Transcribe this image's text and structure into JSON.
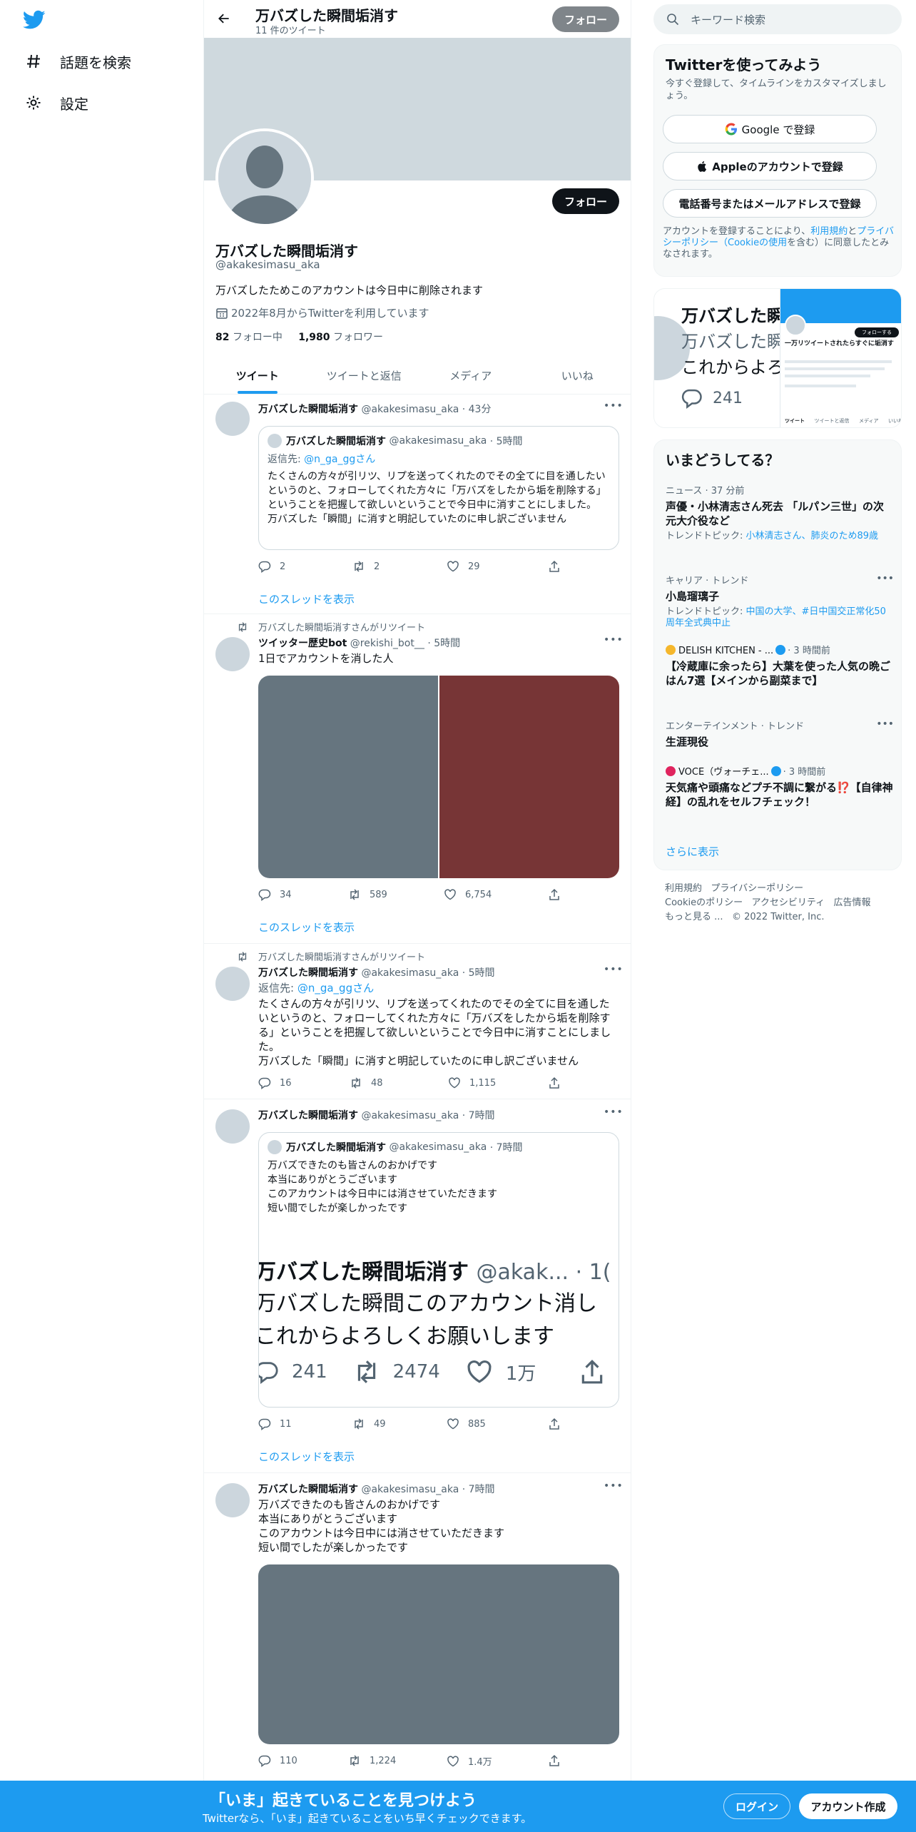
{
  "nav": {
    "items": [
      {
        "label": "話題を検索",
        "icon": "hashtag-icon"
      },
      {
        "label": "設定",
        "icon": "gear-icon"
      }
    ]
  },
  "header": {
    "name": "万バズした瞬間垢消す",
    "count": "11 件のツイート",
    "follow": "フォロー"
  },
  "profile": {
    "follow": "フォロー",
    "name": "万バズした瞬間垢消す",
    "handle": "@akakesimasu_aka",
    "bio": "万バズしたためこのアカウントは今日中に削除されます",
    "joined": "2022年8月からTwitterを利用しています",
    "following_count": "82",
    "following_label": "フォロー中",
    "followers_count": "1,980",
    "followers_label": "フォロワー"
  },
  "tabs": [
    "ツイート",
    "ツイートと返信",
    "メディア",
    "いいね"
  ],
  "tweets": [
    {
      "name": "万バズした瞬間垢消す",
      "handle": "@akakesimasu_aka",
      "time": "· 43分",
      "quote": {
        "name": "万バズした瞬間垢消す",
        "handle": "@akakesimasu_aka",
        "time": "· 5時間",
        "reply_prefix": "返信先: ",
        "reply_to": "@n_ga_ggさん",
        "text1": "たくさんの方々が引リツ、リプを送ってくれたのでその全てに目を通したいというのと、フォローしてくれた方々に「万バズをしたから垢を削除する」ということを把握して欲しいということで今日中に消すことにしました。",
        "text2": "万バズした「瞬間」に消すと明記していたのに申し訳ございません"
      },
      "replies": "2",
      "retweets": "2",
      "likes": "29",
      "show_thread": "このスレッドを表示"
    },
    {
      "rt_label": "万バズした瞬間垢消すさんがリツイート",
      "name": "ツイッター歴史bot",
      "handle": "@rekishi_bot__",
      "time": "· 5時間",
      "text": "1日でアカウントを消した人",
      "replies": "34",
      "retweets": "589",
      "likes": "6,754",
      "show_thread": "このスレッドを表示"
    },
    {
      "rt_label": "万バズした瞬間垢消すさんがリツイート",
      "name": "万バズした瞬間垢消す",
      "handle": "@akakesimasu_aka",
      "time": "· 5時間",
      "reply_prefix": "返信先: ",
      "reply_to": "@n_ga_ggさん",
      "text1": "たくさんの方々が引リツ、リプを送ってくれたのでその全てに目を通したいというのと、フォローしてくれた方々に「万バズをしたから垢を削除する」ということを把握して欲しいということで今日中に消すことにしました。",
      "text2": "万バズした「瞬間」に消すと明記していたのに申し訳ございません",
      "replies": "16",
      "retweets": "48",
      "likes": "1,115"
    },
    {
      "name": "万バズした瞬間垢消す",
      "handle": "@akakesimasu_aka",
      "time": "· 7時間",
      "quote": {
        "name": "万バズした瞬間垢消す",
        "handle": "@akakesimasu_aka",
        "time": "· 7時間",
        "lines": [
          "万バズできたのも皆さんのおかげです",
          "本当にありがとうございます",
          "このアカウントは今日中には消させていただきます",
          "短い間でしたが楽しかったです"
        ],
        "image_head": "万バズした瞬間垢消す",
        "image_handle": "@akak... · 1(",
        "image_line1": "万バズした瞬間このアカウント消し",
        "image_line2": "これからよろしくお願いします",
        "image_replies": "241",
        "image_retweets": "2474",
        "image_likes": "1万"
      },
      "replies": "11",
      "retweets": "49",
      "likes": "885",
      "show_thread": "このスレッドを表示"
    },
    {
      "name": "万バズした瞬間垢消す",
      "handle": "@akakesimasu_aka",
      "time": "· 7時間",
      "lines": [
        "万バズできたのも皆さんのおかげです",
        "本当にありがとうございます",
        "このアカウントは今日中には消させていただきます",
        "短い間でしたが楽しかったです"
      ],
      "replies": "110",
      "retweets": "1,224",
      "likes": "1.4万"
    }
  ],
  "search": {
    "placeholder": "キーワード検索"
  },
  "signup": {
    "title": "Twitterを使ってみよう",
    "subtitle": "今すぐ登録して、タイムラインをカスタマイズしましょう。",
    "google": "Google で登録",
    "apple": "Appleのアカウントで登録",
    "phone": "電話番号またはメールアドレスで登録",
    "terms_prefix": "アカウントを登録することにより、",
    "terms_link": "利用規約",
    "terms_mid": "と",
    "privacy_link": "プライバシーポリシー（Cookieの使用",
    "terms_suffix": "を含む）に同意したとみなされます。"
  },
  "media_preview": {
    "big_line1": "万バズした瞬",
    "big_line2": "万バズした瞬",
    "big_line3": "これからよろ",
    "replies": "241",
    "thumb_follow": "フォローする",
    "thumb_name": "一万リツイートされたらすぐに垢消す",
    "thumb_tabs": [
      "ツイート",
      "ツイートと返信",
      "メディア",
      "いいね"
    ]
  },
  "trends": {
    "title": "いまどうしてる？",
    "items": [
      {
        "meta": "ニュース · 37 分前",
        "name": "声優・小林清志さん死去 「ルパン三世」の次元大介役など",
        "sub_prefix": "トレンドトピック: ",
        "sub_link": "小林清志さん、肺炎のため89歳"
      },
      {
        "meta": "キャリア · トレンド",
        "name": "小島瑠璃子",
        "sub_prefix": "トレンドトピック: ",
        "sub_link": "中国の大学、#日中国交正常化50周年全式典中止"
      },
      {
        "meta": "DELISH KITCHEN - ...",
        "meta_time": "· 3 時間前",
        "name": "【冷蔵庫に余ったら】大葉を使った人気の晩ごはん7選【メインから副菜まで】"
      },
      {
        "meta": "エンターテインメント · トレンド",
        "name": "生涯現役"
      },
      {
        "meta": "VOCE（ヴォーチェ...",
        "meta_time": "· 3 時間前",
        "name": "天気痛や頭痛などプチ不調に繋がる⁉️【自律神経】の乱れをセルフチェック！"
      }
    ],
    "show_more": "さらに表示"
  },
  "footer": {
    "line1": [
      "利用規約",
      "プライバシーポリシー"
    ],
    "line2": [
      "Cookieのポリシー",
      "アクセシビリティ",
      "広告情報"
    ],
    "line3": [
      "もっと見る ...",
      "© 2022 Twitter, Inc."
    ]
  },
  "bottom_bar": {
    "title": "「いま」起きていることを見つけよう",
    "subtitle": "Twitterなら、「いま」起きていることをいち早くチェックできます。",
    "login": "ログイン",
    "signup": "アカウント作成"
  },
  "colors": {
    "accent": "#1d9bf0",
    "dark": "#0f1419",
    "muted": "#536471"
  }
}
